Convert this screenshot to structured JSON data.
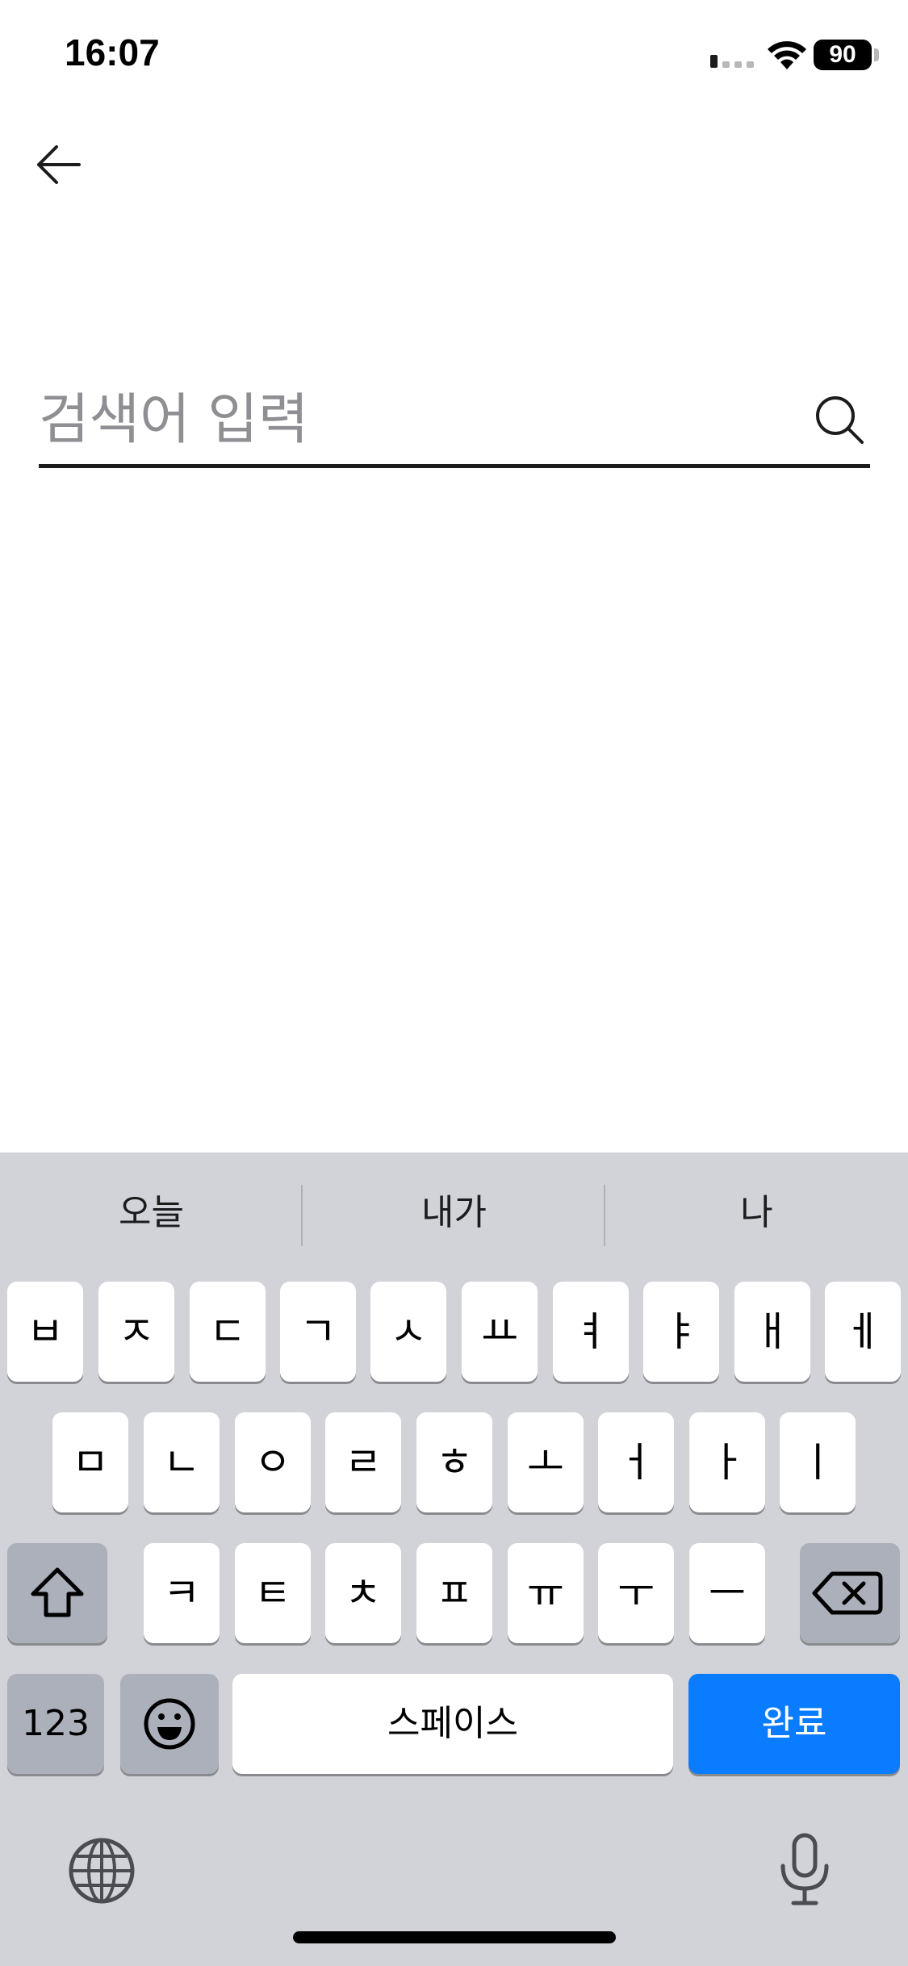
{
  "status_bar": {
    "time": "16:07",
    "battery": "90"
  },
  "header": {
    "back_icon": "arrow-left-icon"
  },
  "search": {
    "placeholder": "검색어 입력",
    "value": "",
    "icon": "search-icon"
  },
  "keyboard": {
    "suggestions": [
      "오늘",
      "내가",
      "나"
    ],
    "row1": [
      "ㅂ",
      "ㅈ",
      "ㄷ",
      "ㄱ",
      "ㅅ",
      "ㅛ",
      "ㅕ",
      "ㅑ",
      "ㅐ",
      "ㅔ"
    ],
    "row2": [
      "ㅁ",
      "ㄴ",
      "ㅇ",
      "ㄹ",
      "ㅎ",
      "ㅗ",
      "ㅓ",
      "ㅏ",
      "ㅣ"
    ],
    "row3": [
      "ㅋ",
      "ㅌ",
      "ㅊ",
      "ㅍ",
      "ㅠ",
      "ㅜ",
      "ㅡ"
    ],
    "numbers_label": "123",
    "space_label": "스페이스",
    "done_label": "완료",
    "colors": {
      "background": "#d1d3d9",
      "key": "#ffffff",
      "function_key": "#abb0ba",
      "done_key": "#0a7cff"
    }
  }
}
